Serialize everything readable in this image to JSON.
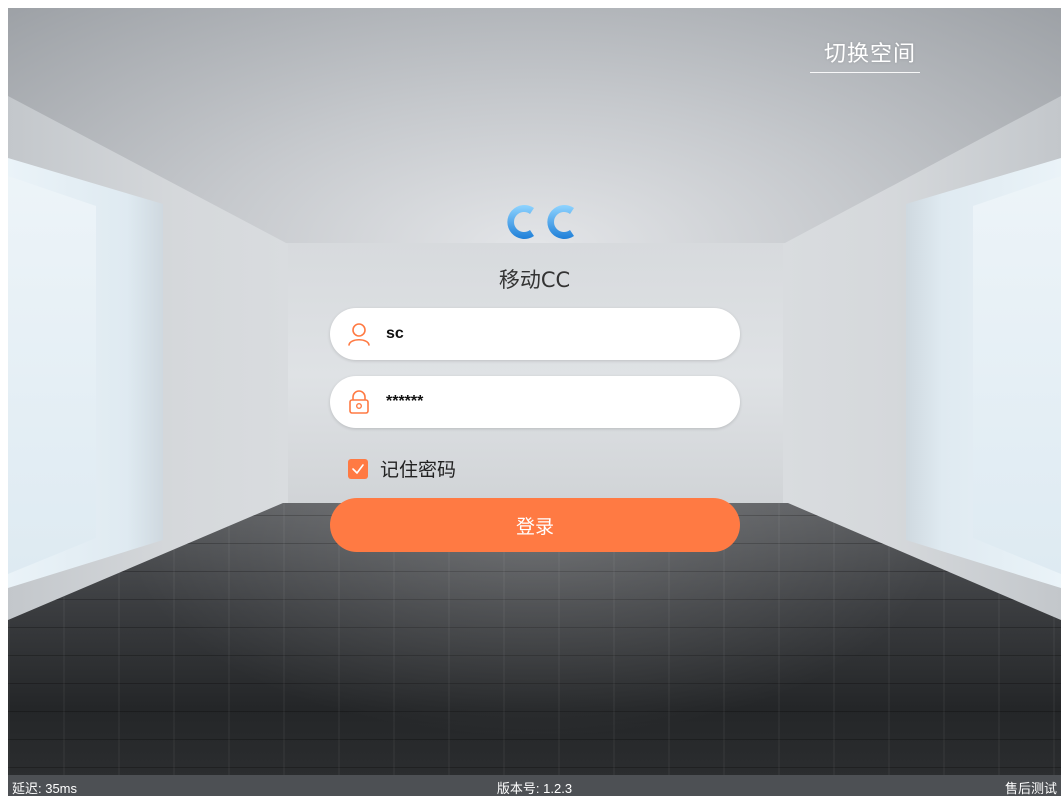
{
  "header": {
    "switch_space_label": "切换空间"
  },
  "app": {
    "logo_text": "CC",
    "name": "移动CC"
  },
  "login_form": {
    "username": {
      "value": "sc",
      "icon": "user-icon"
    },
    "password": {
      "value": "******",
      "icon": "lock-icon"
    },
    "remember_password": {
      "label": "记住密码",
      "checked": true
    },
    "login_button_label": "登录"
  },
  "footer": {
    "latency": "延迟: 35ms",
    "version": "版本号: 1.2.3",
    "after_sales": "售后测试"
  },
  "colors": {
    "accent": "#ff7a43",
    "logo_blue": "#3aa0e8",
    "footer_bg": "#4d5054"
  }
}
